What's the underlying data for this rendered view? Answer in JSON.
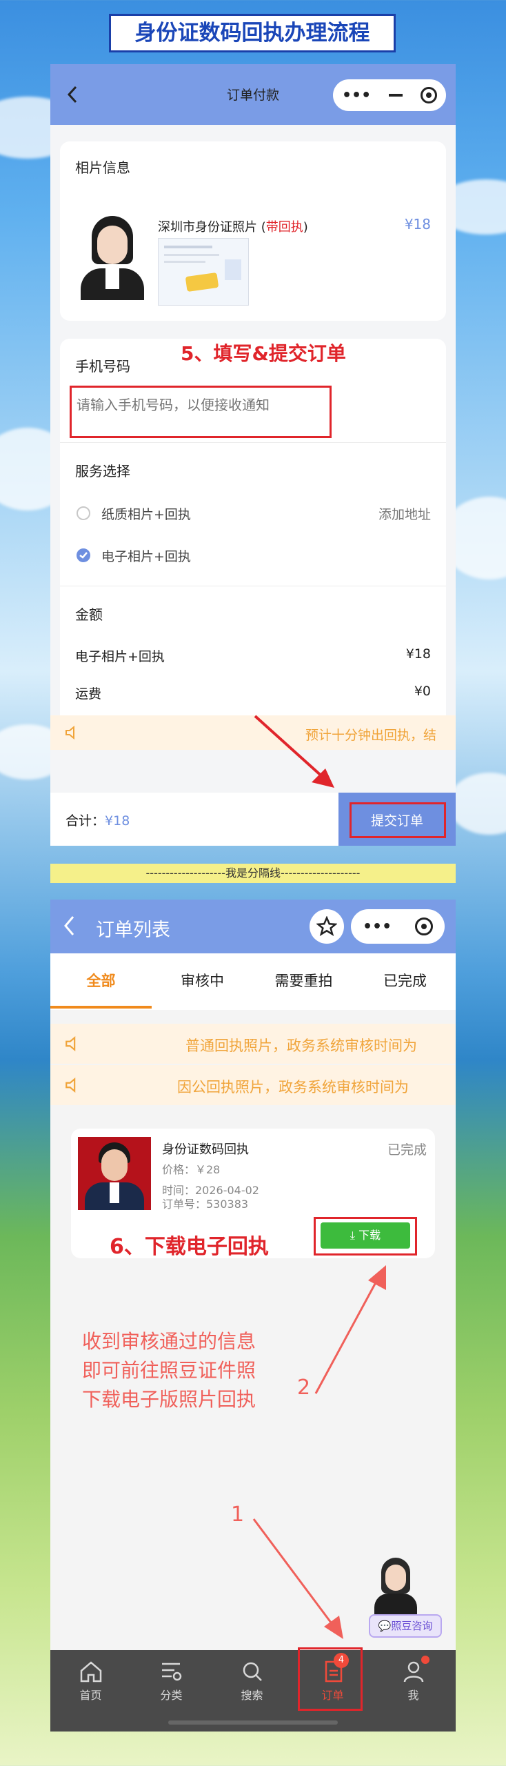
{
  "banner": {
    "title": "身份证数码回执办理流程"
  },
  "order_pay": {
    "nav_title": "订单付款",
    "photo_section": {
      "header": "相片信息",
      "product_name": "深圳市身份证照片 (",
      "product_tag": "带回执",
      "product_close": ")",
      "price": "¥18"
    },
    "step5_label": "5、填写&提交订单",
    "phone_section": {
      "label": "手机号码",
      "placeholder": "请输入手机号码，以便接收通知"
    },
    "service_section": {
      "label": "服务选择",
      "options": [
        {
          "label": "纸质相片+回执",
          "selected": false,
          "extra": "添加地址"
        },
        {
          "label": "电子相片+回执",
          "selected": true,
          "extra": ""
        }
      ]
    },
    "amount_section": {
      "label": "金额",
      "rows": [
        {
          "name": "电子相片+回执",
          "value": "¥18"
        },
        {
          "name": "运费",
          "value": "¥0"
        }
      ]
    },
    "notice": "预计十分钟出回执，结",
    "footer": {
      "total_label": "合计：",
      "total_value": "¥18",
      "submit": "提交订单"
    }
  },
  "separator": "--------------------我是分隔线--------------------",
  "order_list": {
    "nav_title": "订单列表",
    "tabs": [
      {
        "label": "全部",
        "active": true
      },
      {
        "label": "审核中",
        "active": false
      },
      {
        "label": "需要重拍",
        "active": false
      },
      {
        "label": "已完成",
        "active": false
      }
    ],
    "notices": [
      "普通回执照片，政务系统审核时间为",
      "因公回执照片，政务系统审核时间为"
    ],
    "order": {
      "title": "身份证数码回执",
      "status": "已完成",
      "price": "价格：￥28",
      "time": "时间：2026-04-02",
      "order_no": "订单号：530383",
      "download": "下载"
    },
    "step6_label": "6、下载电子回执",
    "instruction": [
      "收到审核通过的信息",
      "即可前往照豆证件照",
      "下载电子版照片回执"
    ],
    "marker_1": "1",
    "marker_2": "2",
    "consult": "照豆咨询",
    "tabbar": [
      {
        "label": "首页",
        "icon": "home-icon"
      },
      {
        "label": "分类",
        "icon": "category-icon"
      },
      {
        "label": "搜索",
        "icon": "search-icon"
      },
      {
        "label": "订单",
        "icon": "order-icon",
        "badge": "4",
        "active": true
      },
      {
        "label": "我",
        "icon": "profile-icon"
      }
    ]
  },
  "colors": {
    "nav_blue": "#7a9ce6",
    "accent_red": "#e0252b",
    "orange": "#f08a1c",
    "green": "#3dbb3d"
  }
}
